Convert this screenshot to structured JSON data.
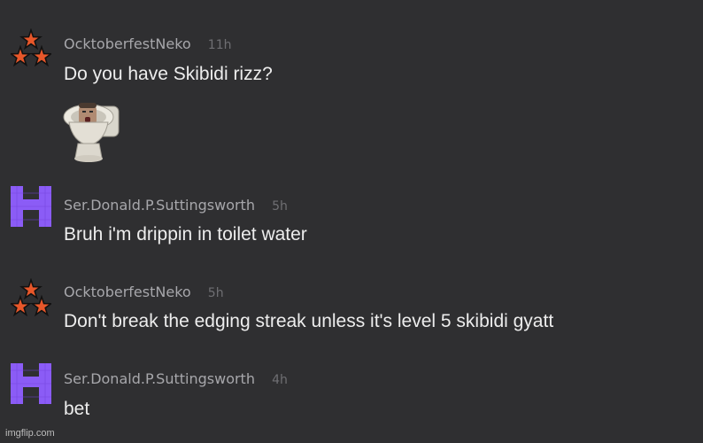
{
  "comments": [
    {
      "username": "OcktoberfestNeko",
      "time": "11h",
      "text": "Do you have Skibidi rizz?",
      "avatar_icon": "three-stars-icon",
      "attachment_icon": "skibidi-toilet-sticker"
    },
    {
      "username": "Ser.Donald.P.Suttingsworth",
      "time": "5h",
      "text": "Bruh i'm drippin in toilet water",
      "avatar_icon": "purple-pixel-h-icon"
    },
    {
      "username": "OcktoberfestNeko",
      "time": "5h",
      "text": "Don't break the edging streak unless it's level 5 skibidi gyatt",
      "avatar_icon": "three-stars-icon"
    },
    {
      "username": "Ser.Donald.P.Suttingsworth",
      "time": "4h",
      "text": "bet",
      "avatar_icon": "purple-pixel-h-icon"
    }
  ],
  "watermark": "imgflip.com",
  "colors": {
    "background": "#2f2f31",
    "username": "#a7a7ab",
    "timestamp": "#6f6f73",
    "text": "#ededed",
    "star_fill": "#e8572a",
    "h_avatar": "#8b5cf6"
  }
}
